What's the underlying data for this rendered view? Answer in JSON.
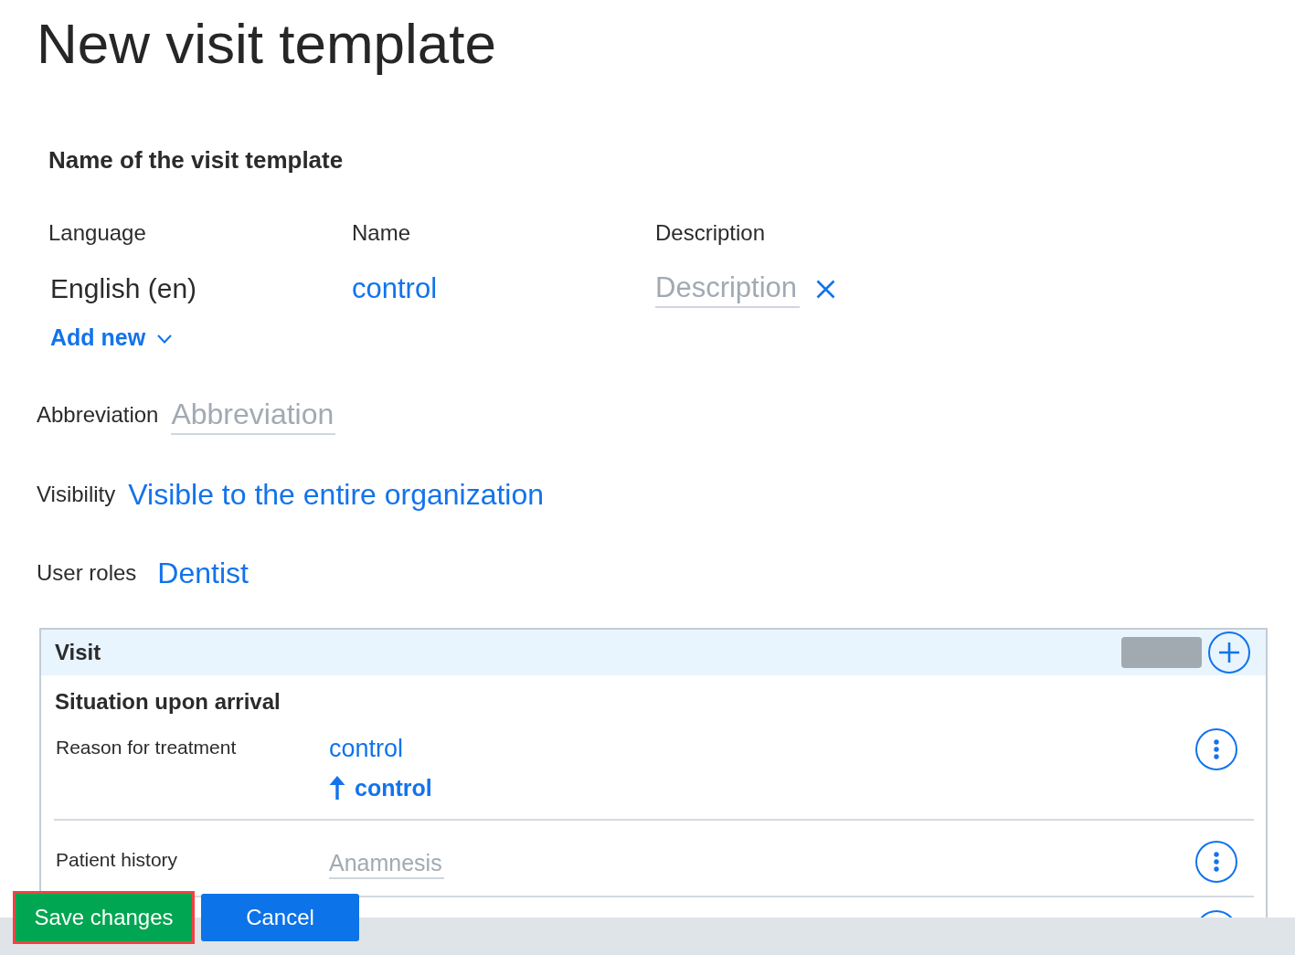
{
  "title": "New visit template",
  "name_section": {
    "heading": "Name of the visit template",
    "columns": [
      "Language",
      "Name",
      "Description"
    ],
    "rows": [
      {
        "language": "English (en)",
        "name": "control",
        "description": {
          "placeholder": "Description"
        },
        "removable": true
      }
    ],
    "add_button": "Add new"
  },
  "abbreviation": {
    "label": "Abbreviation",
    "placeholder": "Abbreviation"
  },
  "visibility": {
    "label": "Visibility",
    "value": "Visible to the entire organization"
  },
  "user_roles": {
    "label": "User roles",
    "value": "Dentist"
  },
  "panel": {
    "title": "Visit",
    "section": "Situation upon arrival",
    "rows": [
      {
        "kind": "values",
        "label": "Reason for treatment",
        "values": [
          {
            "kind": "plain",
            "text": "control"
          },
          {
            "kind": "parent",
            "text": "control"
          }
        ]
      },
      {
        "kind": "placeholder",
        "label": "Patient history",
        "placeholder": "Anamnesis"
      },
      {
        "kind": "clipped"
      }
    ]
  },
  "buttons": [
    {
      "kind": "primary",
      "label": "Save changes",
      "focused": true
    },
    {
      "kind": "secondary",
      "label": "Cancel",
      "focused": false
    }
  ]
}
